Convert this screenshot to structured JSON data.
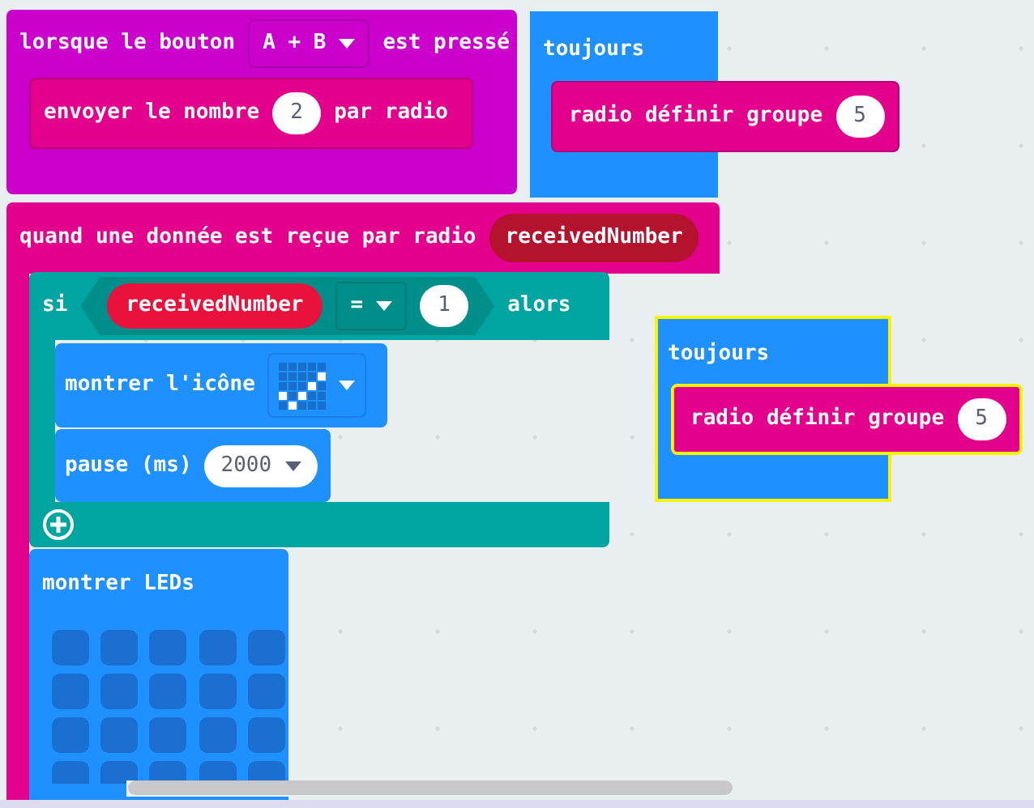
{
  "on_button_pressed": {
    "label": "lorsque le bouton",
    "button": "A + B",
    "suffix": "est pressé",
    "send_number": {
      "label": "envoyer le nombre",
      "value": "2",
      "suffix": "par radio"
    }
  },
  "forever_blocks": [
    {
      "label": "toujours",
      "selected": false,
      "set_group": {
        "label": "radio définir groupe",
        "value": "5"
      }
    },
    {
      "label": "toujours",
      "selected": true,
      "set_group": {
        "label": "radio définir groupe",
        "value": "5"
      }
    }
  ],
  "on_received": {
    "label": "quand une donnée est reçue par radio",
    "variable": "receivedNumber",
    "if_block": {
      "label": "si",
      "variable": "receivedNumber",
      "operator": "=",
      "value": "1",
      "then_label": "alors",
      "show_icon": {
        "label": "montrer l'icône"
      },
      "pause": {
        "label": "pause (ms)",
        "value": "2000"
      }
    },
    "show_leds": {
      "label": "montrer LEDs",
      "leds": [
        [
          false,
          false,
          false,
          false,
          false
        ],
        [
          false,
          false,
          false,
          false,
          false
        ],
        [
          false,
          false,
          false,
          false,
          false
        ],
        [
          false,
          false,
          false,
          false,
          false
        ]
      ]
    }
  }
}
